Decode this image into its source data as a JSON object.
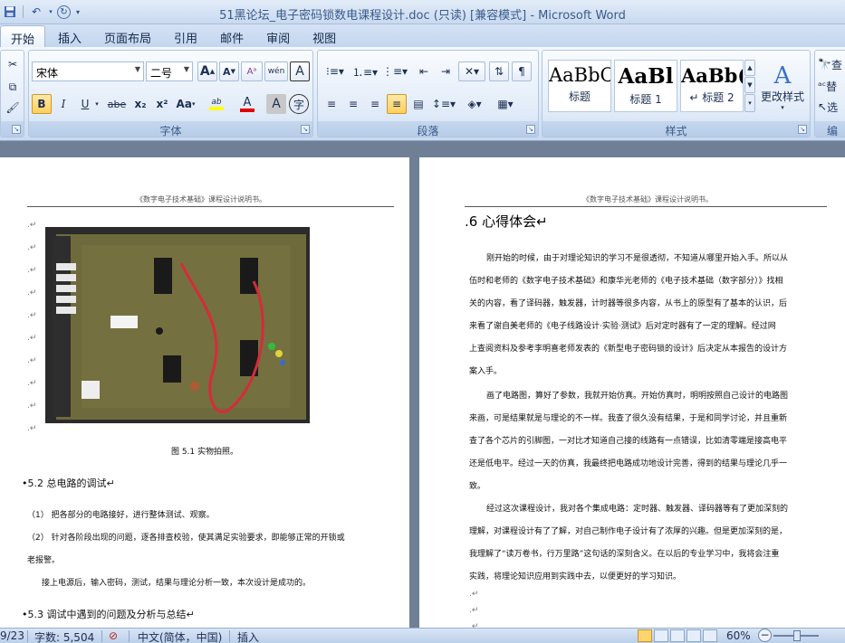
{
  "window": {
    "title": "51黑论坛_电子密码锁数电课程设计.doc (只读) [兼容模式] - Microsoft Word"
  },
  "tabs": [
    "开始",
    "插入",
    "页面布局",
    "引用",
    "邮件",
    "审阅",
    "视图"
  ],
  "ribbon": {
    "font": {
      "label": "字体",
      "name": "宋体",
      "size": "二号",
      "grow": "A",
      "shrink": "A",
      "bold": "B",
      "italic": "I",
      "underline": "U",
      "strike": "abe",
      "subscript": "x₂",
      "superscript": "x²",
      "case": "Aa",
      "highlight": "ab",
      "color": "A",
      "shade": "A",
      "phonetic": "wén",
      "enclose": "字"
    },
    "paragraph": {
      "label": "段落"
    },
    "styles": {
      "label": "样式",
      "items": [
        {
          "sample": "AaBbC",
          "name": "标题"
        },
        {
          "sample": "AaBl",
          "name": "标题 1"
        },
        {
          "sample": "AaBb(",
          "name": "标题 2"
        }
      ],
      "change": "更改样式"
    },
    "editing": {
      "label": "编",
      "find": "查",
      "replace": "替",
      "select": "选"
    }
  },
  "left_page": {
    "header": "《数字电子技术基础》课程设计说明书。",
    "caption": "图 5.1  实物拍照。",
    "sec52": "•5.2   总电路的调试↵",
    "lines": [
      "（1）  把各部分的电路接好，进行整体测试、观察。",
      "（2）  针对各阶段出现的问题，逐各排查校验，使其满足实验要求，即能够正常的开锁或",
      "老报警。",
      "接上电源后，输入密码，测试，结果与理论分析一致，本次设计是成功的。"
    ],
    "sec53": "•5.3   调试中遇到的问题及分析与总结↵"
  },
  "right_page": {
    "header": "《数字电子技术基础》课程设计说明书。",
    "heading": ".6 心得体会↵",
    "lines": [
      "刚开始的时候，由于对理论知识的学习不是很透彻，不知道从哪里开始入手。所以从",
      "伍时和老师的《数字电子技术基础》和康华光老师的《电子技术基础（数字部分）》找相",
      "关的内容，看了译码器，触发器，计时器等很多内容，从书上的原型有了基本的认识，后",
      "来看了谢自美老师的《电子线路设计·实验·测试》后对定时器有了一定的理解。经过网",
      "上查阅资料及参考李明喜老师发表的《新型电子密码锁的设计》后决定从本报告的设计方",
      "案入手。",
      "画了电路图，算好了参数，我就开始仿真。开始仿真时，明明按照自己设计的电路图",
      "来画，可是结果就是与理论的不一样。我查了很久没有结果，于是和同学讨论，并且重新",
      "查了各个芯片的引脚图，一对比才知道自己接的线路有一点错误，比如清零端是接高电平",
      "还是低电平。经过一天的仿真，我最终把电路成功地设计完善，得到的结果与理论几乎一",
      "致。",
      "经过这次课程设计，我对各个集成电路：定时器、触发器、译码器等有了更加深刻的",
      "理解，对课程设计有了了解，对自己制作电子设计有了浓厚的兴趣。但是更加深刻的是，",
      "我理解了“读万卷书，行万里路”这句话的深刻含义。在以后的专业学习中，我将会注重",
      "实践，将理论知识应用到实践中去，以便更好的学习知识。"
    ]
  },
  "status": {
    "page": "9/23",
    "words": "字数: 5,504",
    "lang": "中文(简体，中国)",
    "mode": "插入",
    "zoom": "60%"
  }
}
